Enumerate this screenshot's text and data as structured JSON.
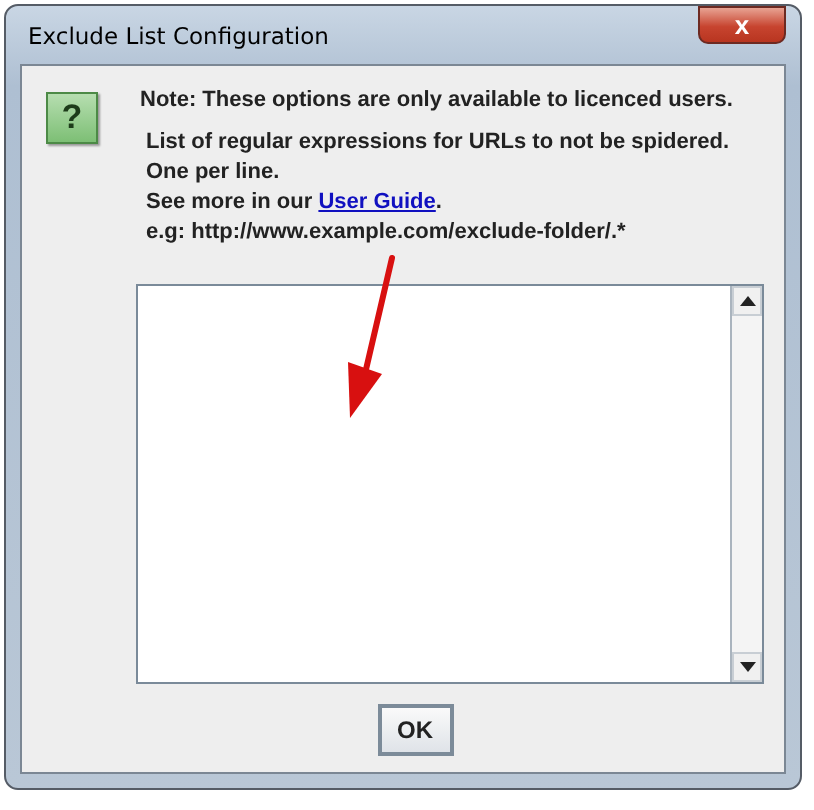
{
  "window": {
    "title": "Exclude List Configuration",
    "close_glyph": "x"
  },
  "dialog": {
    "icon_glyph": "?",
    "note": "Note: These options are only available to licenced users.",
    "lines": [
      "List of regular expressions for URLs to not be spidered.",
      "One per line."
    ],
    "guide": {
      "before": "See more in our ",
      "link": "User Guide",
      "after": "."
    },
    "example": "e.g: http://www.example.com/exclude-folder/.*",
    "buttons": [
      "OK"
    ]
  }
}
